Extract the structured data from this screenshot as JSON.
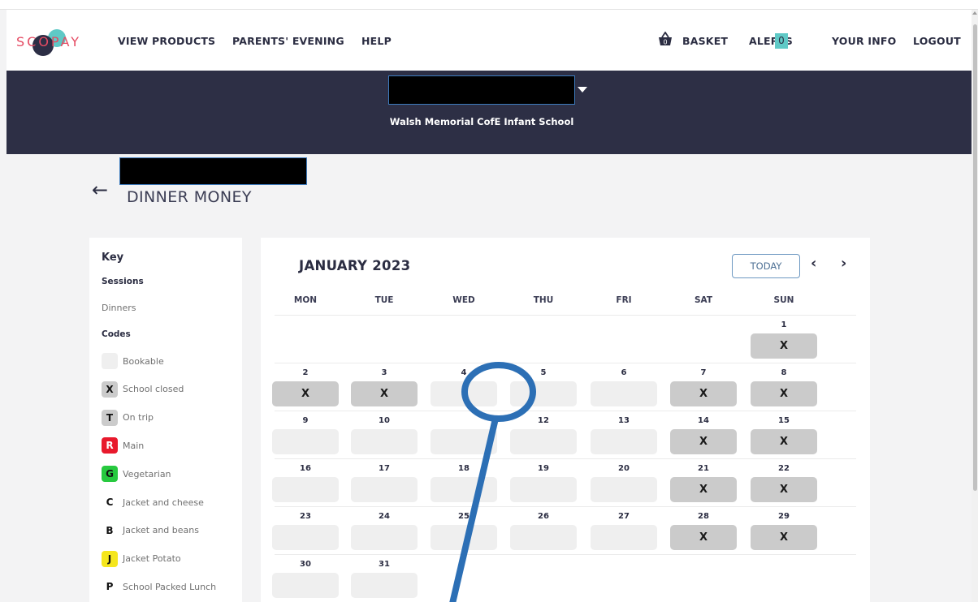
{
  "brand": {
    "logo_text": "SCOPAY"
  },
  "nav": {
    "view_products": "VIEW PRODUCTS",
    "parents_evening": "PARENTS' EVENING",
    "help": "HELP",
    "basket": "BASKET",
    "basket_count": "0",
    "alerts": "ALERTS",
    "alerts_count": "0",
    "your_info": "YOUR INFO",
    "logout": "LOGOUT"
  },
  "banner": {
    "school_name": "Walsh Memorial CofE Infant School"
  },
  "page": {
    "title": "DINNER MONEY"
  },
  "key": {
    "title": "Key",
    "sessions_heading": "Sessions",
    "session_dinners": "Dinners",
    "codes_heading": "Codes",
    "codes": [
      {
        "letter": "",
        "label": "Bookable",
        "color": "#efefef"
      },
      {
        "letter": "X",
        "label": "School closed",
        "color": "#cbcbcb"
      },
      {
        "letter": "T",
        "label": "On trip",
        "color": "#cbcbcb"
      },
      {
        "letter": "R",
        "label": "Main",
        "color": "#e8192c"
      },
      {
        "letter": "G",
        "label": "Vegetarian",
        "color": "#27c93f"
      },
      {
        "letter": "C",
        "label": "Jacket and cheese",
        "color": "#ffffff"
      },
      {
        "letter": "B",
        "label": "Jacket and beans",
        "color": "#ffffff"
      },
      {
        "letter": "J",
        "label": "Jacket Potato",
        "color": "#f5e61d"
      },
      {
        "letter": "P",
        "label": "School Packed Lunch",
        "color": "#ffffff"
      }
    ]
  },
  "calendar": {
    "month": "JANUARY 2023",
    "today_label": "TODAY",
    "prev_symbol": "‹",
    "next_symbol": "›",
    "weekdays": [
      "MON",
      "TUE",
      "WED",
      "THU",
      "FRI",
      "SAT",
      "SUN"
    ],
    "weeks": [
      [
        null,
        null,
        null,
        null,
        null,
        null,
        {
          "day": "1",
          "code": "X"
        }
      ],
      [
        {
          "day": "2",
          "code": "X"
        },
        {
          "day": "3",
          "code": "X"
        },
        {
          "day": "4",
          "code": ""
        },
        {
          "day": "5",
          "code": ""
        },
        {
          "day": "6",
          "code": ""
        },
        {
          "day": "7",
          "code": "X"
        },
        {
          "day": "8",
          "code": "X"
        }
      ],
      [
        {
          "day": "9",
          "code": ""
        },
        {
          "day": "10",
          "code": ""
        },
        {
          "day": "",
          "code": ""
        },
        {
          "day": "12",
          "code": ""
        },
        {
          "day": "13",
          "code": ""
        },
        {
          "day": "14",
          "code": "X"
        },
        {
          "day": "15",
          "code": "X"
        }
      ],
      [
        {
          "day": "16",
          "code": ""
        },
        {
          "day": "17",
          "code": ""
        },
        {
          "day": "18",
          "code": ""
        },
        {
          "day": "19",
          "code": ""
        },
        {
          "day": "20",
          "code": ""
        },
        {
          "day": "21",
          "code": "X"
        },
        {
          "day": "22",
          "code": "X"
        }
      ],
      [
        {
          "day": "23",
          "code": ""
        },
        {
          "day": "24",
          "code": ""
        },
        {
          "day": "25",
          "code": ""
        },
        {
          "day": "26",
          "code": ""
        },
        {
          "day": "27",
          "code": ""
        },
        {
          "day": "28",
          "code": "X"
        },
        {
          "day": "29",
          "code": "X"
        }
      ],
      [
        {
          "day": "30",
          "code": ""
        },
        {
          "day": "31",
          "code": ""
        },
        null,
        null,
        null,
        null,
        null
      ]
    ]
  },
  "colors": {
    "banner": "#2d2f45",
    "accent_teal": "#5fc9c6",
    "brand_red": "#e54b63",
    "closed_cell": "#cbcbcb",
    "bookable_cell": "#efefef",
    "annotation_blue": "#2c6fb5"
  }
}
